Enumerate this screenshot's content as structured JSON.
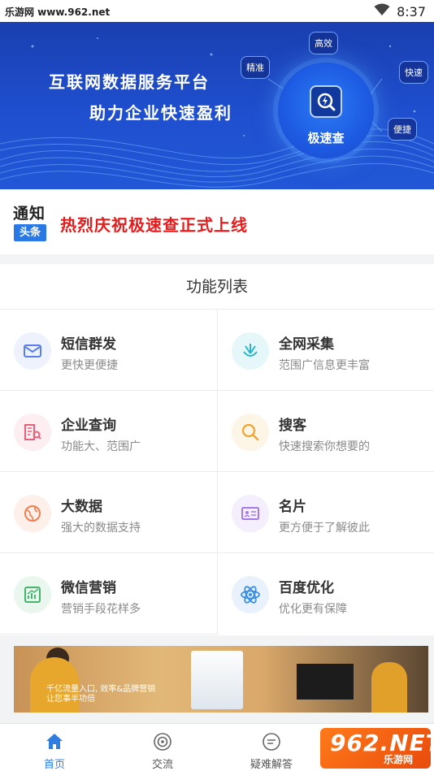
{
  "status_bar": {
    "site_text": "乐游网 www.962.net",
    "time": "8:37"
  },
  "banner": {
    "headline_1": "互联网数据服务平台",
    "headline_2": "助力企业快速盈利",
    "product_name": "极速查",
    "tags": [
      "高效",
      "精准",
      "快速",
      "便捷"
    ],
    "slide_count": 3,
    "active_slide": 2
  },
  "notice": {
    "logo_top": "通知",
    "logo_badge": "头条",
    "text": "热烈庆祝极速查正式上线"
  },
  "functions": {
    "title": "功能列表",
    "items": [
      {
        "title": "短信群发",
        "subtitle": "更快更便捷",
        "icon": "mail-icon",
        "color": "#5b7fe8",
        "bg": "#eef2fd"
      },
      {
        "title": "全网采集",
        "subtitle": "范围广信息更丰富",
        "icon": "collect-icon",
        "color": "#2ab6c9",
        "bg": "#e6f7f9"
      },
      {
        "title": "企业查询",
        "subtitle": "功能大、范围广",
        "icon": "company-search-icon",
        "color": "#e8617a",
        "bg": "#fdeef1"
      },
      {
        "title": "搜客",
        "subtitle": "快速搜索你想要的",
        "icon": "search-icon",
        "color": "#f0a531",
        "bg": "#fdf5e6"
      },
      {
        "title": "大数据",
        "subtitle": "强大的数据支持",
        "icon": "globe-icon",
        "color": "#f07d4f",
        "bg": "#fdf0ea"
      },
      {
        "title": "名片",
        "subtitle": "更方便于了解彼此",
        "icon": "card-icon",
        "color": "#a47be6",
        "bg": "#f4eefd"
      },
      {
        "title": "微信营销",
        "subtitle": "营销手段花样多",
        "icon": "chart-icon",
        "color": "#45b56b",
        "bg": "#eaf7ee"
      },
      {
        "title": "百度优化",
        "subtitle": "优化更有保障",
        "icon": "atom-icon",
        "color": "#3a8fe0",
        "bg": "#e9f2fc"
      }
    ]
  },
  "ad": {
    "caption_line1": "千亿流量入口, 效率&品牌营销",
    "caption_line2": "让您事半功倍"
  },
  "bottom_nav": {
    "items": [
      {
        "label": "首页",
        "icon": "home-icon",
        "active": true
      },
      {
        "label": "交流",
        "icon": "chat-icon",
        "active": false
      },
      {
        "label": "疑难解答",
        "icon": "faq-icon",
        "active": false
      },
      {
        "label": "",
        "icon": "user-icon",
        "active": false
      }
    ]
  },
  "watermark": {
    "big": "962.NET",
    "small": "乐游网"
  }
}
